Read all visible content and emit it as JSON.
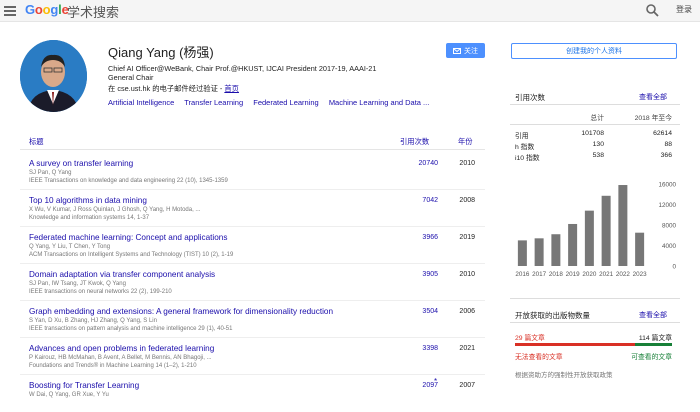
{
  "header": {
    "logo": [
      "G",
      "o",
      "o",
      "g",
      "l",
      "e"
    ],
    "logo_colors": [
      "#4285F4",
      "#EA4335",
      "#FBBC05",
      "#4285F4",
      "#34A853",
      "#EA4335"
    ],
    "product": "学术搜索",
    "login": "登录"
  },
  "profile": {
    "name": "Qiang Yang (杨强)",
    "affiliation_line1": "Chief AI Officer@WeBank, Chair Prof.@HKUST, IJCAI President 2017-19, AAAI-21",
    "affiliation_line2": "General Chair",
    "verified_prefix": "在 cse.ust.hk 的电子邮件经过验证 - ",
    "verified_link": "首页",
    "interests": [
      "Artificial Intelligence",
      "Transfer Learning",
      "Federated Learning",
      "Machine Learning and Data ..."
    ],
    "follow_label": "关注",
    "create_profile_label": "创建我的个人资料"
  },
  "table": {
    "col_title": "标题",
    "col_cited": "引用次数",
    "col_year": "年份",
    "rows": [
      {
        "title": "A survey on transfer learning",
        "authors": "SJ Pan, Q Yang",
        "venue": "IEEE Transactions on knowledge and data engineering 22 (10), 1345-1359",
        "cites": "20740",
        "year": "2010"
      },
      {
        "title": "Top 10 algorithms in data mining",
        "authors": "X Wu, V Kumar, J Ross Quinlan, J Ghosh, Q Yang, H Motoda, ...",
        "venue": "Knowledge and information systems 14, 1-37",
        "cites": "7042",
        "year": "2008"
      },
      {
        "title": "Federated machine learning: Concept and applications",
        "authors": "Q Yang, Y Liu, T Chen, Y Tong",
        "venue": "ACM Transactions on Intelligent Systems and Technology (TIST) 10 (2), 1-19",
        "cites": "3966",
        "year": "2019"
      },
      {
        "title": "Domain adaptation via transfer component analysis",
        "authors": "SJ Pan, IW Tsang, JT Kwok, Q Yang",
        "venue": "IEEE transactions on neural networks 22 (2), 199-210",
        "cites": "3905",
        "year": "2010"
      },
      {
        "title": "Graph embedding and extensions: A general framework for dimensionality reduction",
        "authors": "S Yan, D Xu, B Zhang, HJ Zhang, Q Yang, S Lin",
        "venue": "IEEE transactions on pattern analysis and machine intelligence 29 (1), 40-51",
        "cites": "3504",
        "year": "2006"
      },
      {
        "title": "Advances and open problems in federated learning",
        "authors": "P Kairouz, HB McMahan, B Avent, A Bellet, M Bennis, AN Bhagoji, ...",
        "venue": "Foundations and Trends® in Machine Learning 14 (1–2), 1-210",
        "cites": "3398",
        "year": "2021"
      },
      {
        "title": "Boosting for Transfer Learning",
        "authors": "W Dai, Q Yang, GR Xue, Y Yu",
        "venue": "",
        "cites": "2097",
        "year": "2007"
      }
    ],
    "star": "*"
  },
  "stats": {
    "title": "引用次数",
    "view_all": "查看全部",
    "col_all": "总计",
    "col_since": "2018 年至今",
    "rows": [
      {
        "label": "引用",
        "all": "101708",
        "since": "62614"
      },
      {
        "label": "h 指数",
        "all": "130",
        "since": "88"
      },
      {
        "label": "i10 指数",
        "all": "538",
        "since": "366"
      }
    ]
  },
  "chart_data": {
    "type": "bar",
    "categories": [
      "2016",
      "2017",
      "2018",
      "2019",
      "2020",
      "2021",
      "2022",
      "2023"
    ],
    "values": [
      5000,
      5400,
      6200,
      8200,
      10800,
      13700,
      15800,
      6500
    ],
    "ylim": [
      0,
      16000
    ],
    "yticks": [
      "16000",
      "12000",
      "8000",
      "4000",
      "0"
    ],
    "bar_color": "#777777"
  },
  "open_access": {
    "title": "开放获取的出版物数量",
    "view_all": "查看全部",
    "unavailable_count": "29 篇文章",
    "available_count": "114 篇文章",
    "unavailable_label": "无法查看的文章",
    "available_label": "可查看的文章",
    "note": "根据资助方的强制性开放获取政策"
  }
}
